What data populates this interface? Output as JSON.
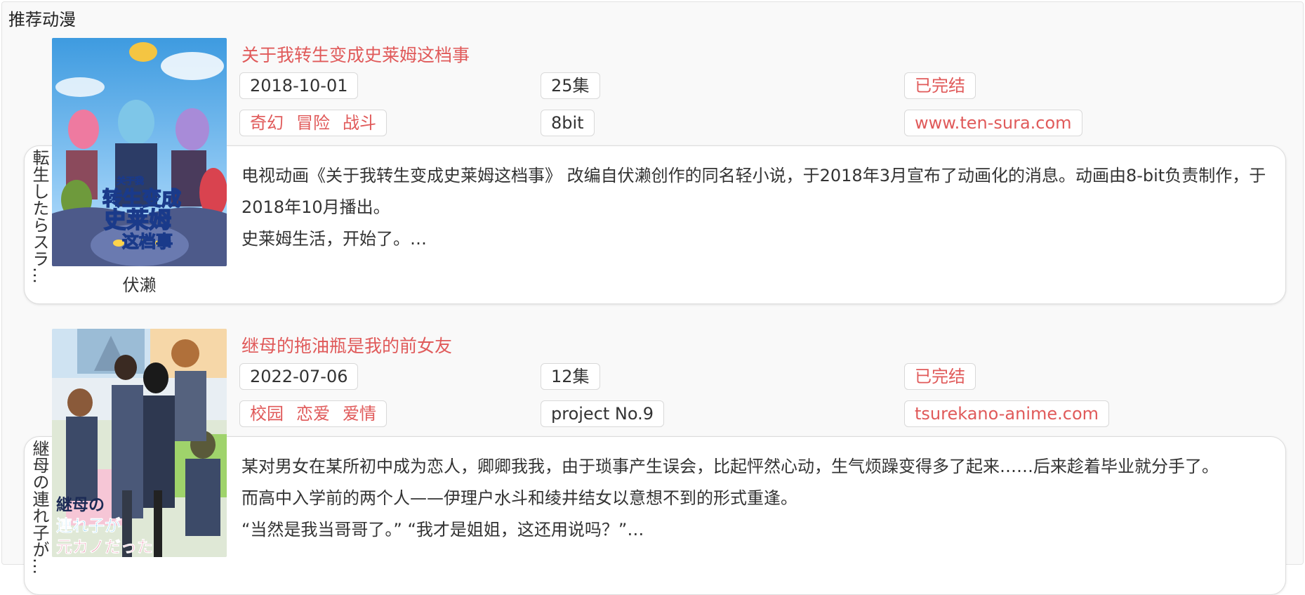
{
  "section": {
    "title": "推荐动漫"
  },
  "items": [
    {
      "jp_title": "転生したらスラ…",
      "cn_title": "关于我转生变成史莱姆这档事",
      "date": "2018-10-01",
      "episodes": "25集",
      "status": "已完结",
      "genres": [
        "奇幻",
        "冒险",
        "战斗"
      ],
      "studio": "8bit",
      "website": "www.ten-sura.com",
      "author": "伏濑",
      "cover_text": [
        "关于我",
        "转生变成",
        "史莱姆",
        "这档事"
      ],
      "description": [
        "电视动画《关于我转生变成史莱姆这档事》 改编自伏濑创作的同名轻小说，于2018年3月宣布了动画化的消息。动画由8-bit负责制作，于2018年10月播出。",
        "史莱姆生活，开始了。…"
      ]
    },
    {
      "jp_title": "継母の連れ子が…",
      "cn_title": "继母的拖油瓶是我的前女友",
      "date": "2022-07-06",
      "episodes": "12集",
      "status": "已完结",
      "genres": [
        "校园",
        "恋爱",
        "爱情"
      ],
      "studio": "project No.9",
      "website": "tsurekano-anime.com",
      "author": "",
      "cover_text": [
        "継母の",
        "連れ子が",
        "元カノだった"
      ],
      "description": [
        "某对男女在某所初中成为恋人，卿卿我我，由于琐事产生误会，比起怦然心动，生气烦躁变得多了起来……后来趁着毕业就分手了。",
        "而高中入学前的两个人——伊理户水斗和绫井结女以意想不到的形式重逢。",
        "“当然是我当哥哥了。” “我才是姐姐，这还用说吗？”…"
      ]
    }
  ],
  "colors": {
    "accent": "#e05a5a",
    "panel_bg": "#f9f9f9",
    "card_border": "#dcdcdc"
  }
}
